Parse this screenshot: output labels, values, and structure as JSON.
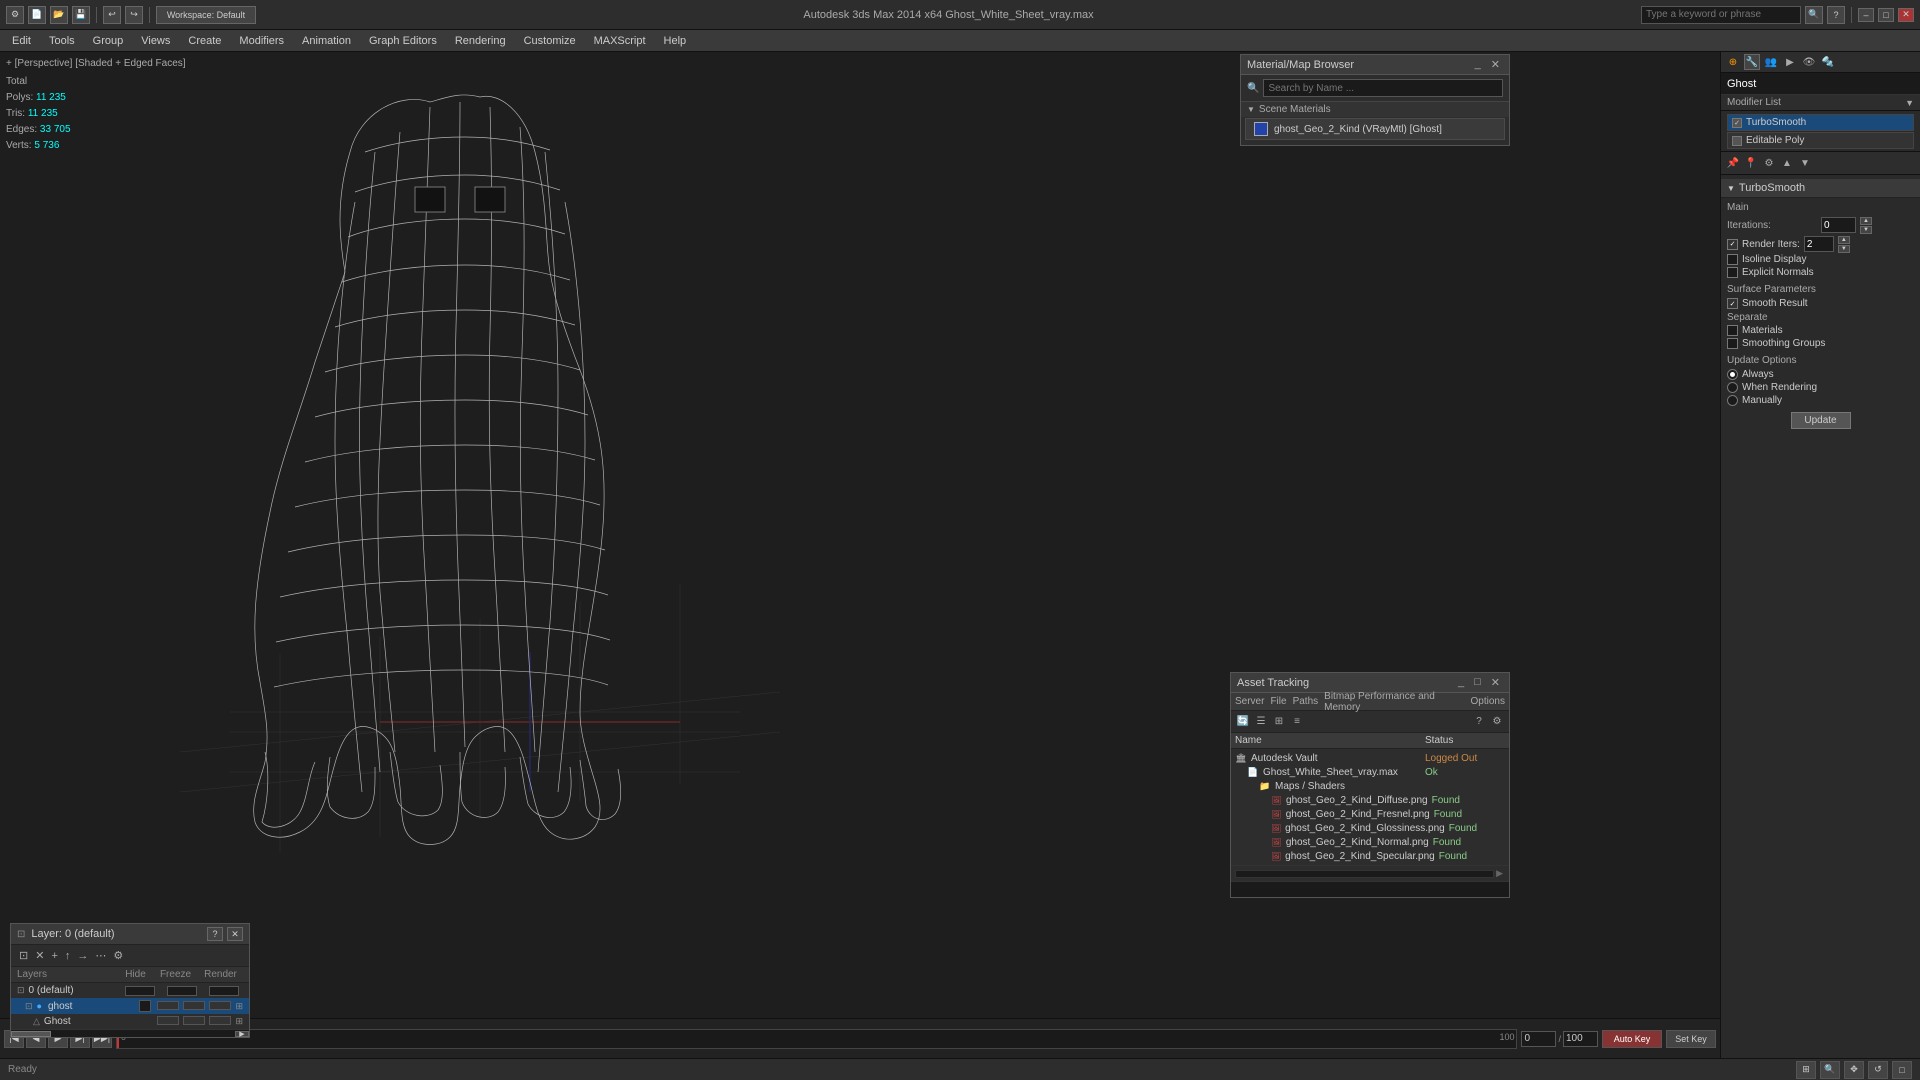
{
  "app": {
    "title": "Autodesk 3ds Max 2014 x64    Ghost_White_Sheet_vray.max",
    "workspace": "Workspace: Default",
    "search_placeholder": "Type a keyword or phrase"
  },
  "titlebar": {
    "min": "–",
    "max": "□",
    "close": "✕"
  },
  "menubar": {
    "items": [
      "Edit",
      "Tools",
      "Group",
      "Views",
      "Create",
      "Modifiers",
      "Animation",
      "Graph Editors",
      "Rendering",
      "Customize",
      "MAXScript",
      "Help"
    ]
  },
  "viewport": {
    "label": "+ [Perspective] [Shaded + Edged Faces]",
    "stats": {
      "polys_label": "Polys:",
      "polys_value": "11 235",
      "tris_label": "Tris:",
      "tris_value": "11 235",
      "edges_label": "Edges:",
      "edges_value": "33 705",
      "verts_label": "Verts:",
      "verts_value": "5 736"
    }
  },
  "right_panel": {
    "object_name": "Ghost",
    "modifier_list_label": "Modifier List",
    "modifiers": [
      {
        "name": "TurboSmooth",
        "selected": true
      },
      {
        "name": "Editable Poly",
        "selected": false
      }
    ],
    "turbosmooth": {
      "title": "TurboSmooth",
      "main_label": "Main",
      "iterations_label": "Iterations:",
      "iterations_value": "0",
      "render_iters_label": "Render Iters:",
      "render_iters_value": "2",
      "isoline_label": "Isoline Display",
      "explicit_normals_label": "Explicit Normals",
      "surface_params_label": "Surface Parameters",
      "smooth_result_label": "Smooth Result",
      "smooth_result_checked": true,
      "separate_label": "Separate",
      "materials_label": "Materials",
      "smoothing_groups_label": "Smoothing Groups",
      "update_options_label": "Update Options",
      "always_label": "Always",
      "when_rendering_label": "When Rendering",
      "manually_label": "Manually",
      "update_btn": "Update"
    }
  },
  "mat_browser": {
    "title": "Material/Map Browser",
    "search_placeholder": "Search by Name ...",
    "scene_materials_label": "Scene Materials",
    "materials": [
      {
        "name": "ghost_Geo_2_Kind (VRayMtl) [Ghost]",
        "type": "vray"
      }
    ]
  },
  "asset_tracking": {
    "title": "Asset Tracking",
    "menu_items": [
      "Server",
      "File",
      "Paths",
      "Bitmap Performance and Memory",
      "Options"
    ],
    "columns": [
      "Name",
      "Status"
    ],
    "items": [
      {
        "indent": 0,
        "icon": "vault",
        "name": "Autodesk Vault",
        "status": "Logged Out"
      },
      {
        "indent": 1,
        "icon": "file",
        "name": "Ghost_White_Sheet_vray.max",
        "status": "Ok"
      },
      {
        "indent": 2,
        "icon": "folder",
        "name": "Maps / Shaders",
        "status": ""
      },
      {
        "indent": 3,
        "icon": "img",
        "name": "ghost_Geo_2_Kind_Diffuse.png",
        "status": "Found"
      },
      {
        "indent": 3,
        "icon": "img",
        "name": "ghost_Geo_2_Kind_Fresnel.png",
        "status": "Found"
      },
      {
        "indent": 3,
        "icon": "img",
        "name": "ghost_Geo_2_Kind_Glossiness.png",
        "status": "Found"
      },
      {
        "indent": 3,
        "icon": "img",
        "name": "ghost_Geo_2_Kind_Normal.png",
        "status": "Found"
      },
      {
        "indent": 3,
        "icon": "img",
        "name": "ghost_Geo_2_Kind_Specular.png",
        "status": "Found"
      }
    ]
  },
  "layers": {
    "title": "Layers",
    "panel_title": "Layer: 0 (default)",
    "columns": [
      "Layers",
      "Hide",
      "Freeze",
      "Render"
    ],
    "items": [
      {
        "indent": 0,
        "icon": "layer",
        "name": "0 (default)",
        "selected": false
      },
      {
        "indent": 1,
        "icon": "ghost",
        "name": "ghost",
        "selected": true
      },
      {
        "indent": 2,
        "icon": "obj",
        "name": "Ghost",
        "selected": false
      }
    ]
  },
  "timeline": {
    "start": "0",
    "end": "100"
  }
}
